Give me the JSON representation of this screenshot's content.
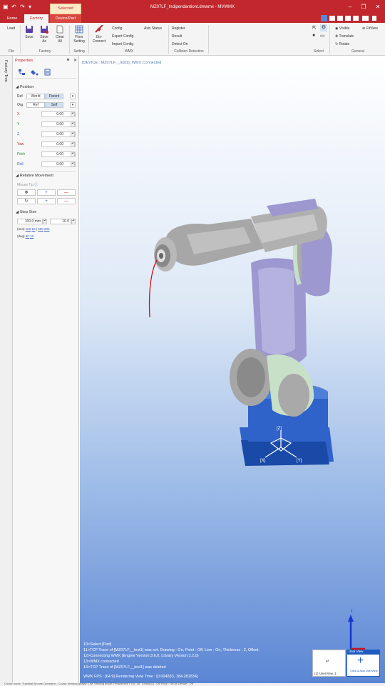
{
  "window": {
    "title": "MZ07LF_Indipendantiont.dmwmx - MVWMX",
    "context_tab": "Selected",
    "qat": [
      "▣",
      "↶",
      "↷",
      "▾"
    ],
    "minimize": "–",
    "restore": "❐",
    "close": "✕"
  },
  "tabs": [
    {
      "label": "Home"
    },
    {
      "label": "Factory"
    },
    {
      "label": "Device/Part"
    }
  ],
  "ribbon": {
    "load": "Load",
    "save": "Save",
    "save_as": "Save As",
    "clear_all": "Clear All",
    "floor_setting": "Floor Setting",
    "disconnect": "Dis- Connect",
    "config": "Config",
    "export_config": "Export Config",
    "import_config": "Import Config",
    "axis_status": "Axis Status",
    "register": "Register",
    "result": "Result",
    "detect_on": "Detect On",
    "visible": "Visible",
    "translate": "Translate",
    "rotate": "Rotate",
    "fit_view": "FitView",
    "groups": {
      "file": "File",
      "factory": "Factory",
      "setting": "Setting",
      "wmx": "WMX",
      "collision": "Collision Detection",
      "select": "Select",
      "general": "General"
    }
  },
  "left_strip": {
    "label": "Factory Tree"
  },
  "properties": {
    "title": "Properties",
    "pin": "ᵾ",
    "close": "✕",
    "position_section": "Position",
    "ref_label": "Ref",
    "ref_options": [
      "World",
      "Parent"
    ],
    "org_label": "Org",
    "org_options": [
      "Ref",
      "Self"
    ],
    "fields": [
      {
        "label": "X",
        "value": "0.00",
        "color": "#c1272d"
      },
      {
        "label": "Y",
        "value": "0.00",
        "color": "#2e8b3a"
      },
      {
        "label": "Z",
        "value": "0.00",
        "color": "#3a5fbf"
      },
      {
        "label": "Yaw",
        "value": "0.00",
        "color": "#c1272d"
      },
      {
        "label": "Pitch",
        "value": "0.00",
        "color": "#2e8b3a"
      },
      {
        "label": "Roll",
        "value": "0.00",
        "color": "#3a5fbf"
      }
    ],
    "relative_section": "Relative Movement",
    "mouse_tip": "Mouse Tip",
    "step_section": "Step Size",
    "step_mm": "100.0 mm",
    "step_deg": "10.0",
    "mm_label": "(mm)",
    "mm_presets": [
      "100",
      "10",
      "500",
      "200"
    ],
    "deg_label": "(deg)",
    "deg_presets": [
      "90",
      "10"
    ]
  },
  "viewport": {
    "device_header": "[DEVICE : MZ07LF__test1], WMX Connected",
    "axis_labels": {
      "z": "[Z]",
      "x": "[X]",
      "y": "[Y]"
    },
    "log": [
      "10>Select [Part]",
      "11>TCP Trace of [MZ07LF__test1] was set. Drawing : On, Point : Off, Line : On, Thickness : 2, Offset :",
      "12>Connecting WMX (Engine Version:3.6.0, Library Version:1.2.0)",
      "13>WMX connected",
      "14>TCP Trace of [MZ07LF__test1] was deleted"
    ],
    "fps": "WMX FPS : [64.9] Rendering View Time : [0.004833, 184.281834]",
    "user_view_title": "User View",
    "user_view_1": "(1) UserView_1",
    "add_user_view": "Click & Add UserView"
  },
  "status": {
    "text": "Cruise mode: Trackball    Mouse Operation : Cruise    Viewing quality: Low    Viewing mode: Perspective    FOV: 45°    Gizmo(G) : Off    Floor : Off    All Device : Off"
  },
  "colors": {
    "brand": "#c1272d",
    "robot_body": "#9d98cf",
    "robot_base": "#1f5bbf",
    "robot_joint": "#a9a9a9",
    "tcp_trace": "#d1121a"
  }
}
